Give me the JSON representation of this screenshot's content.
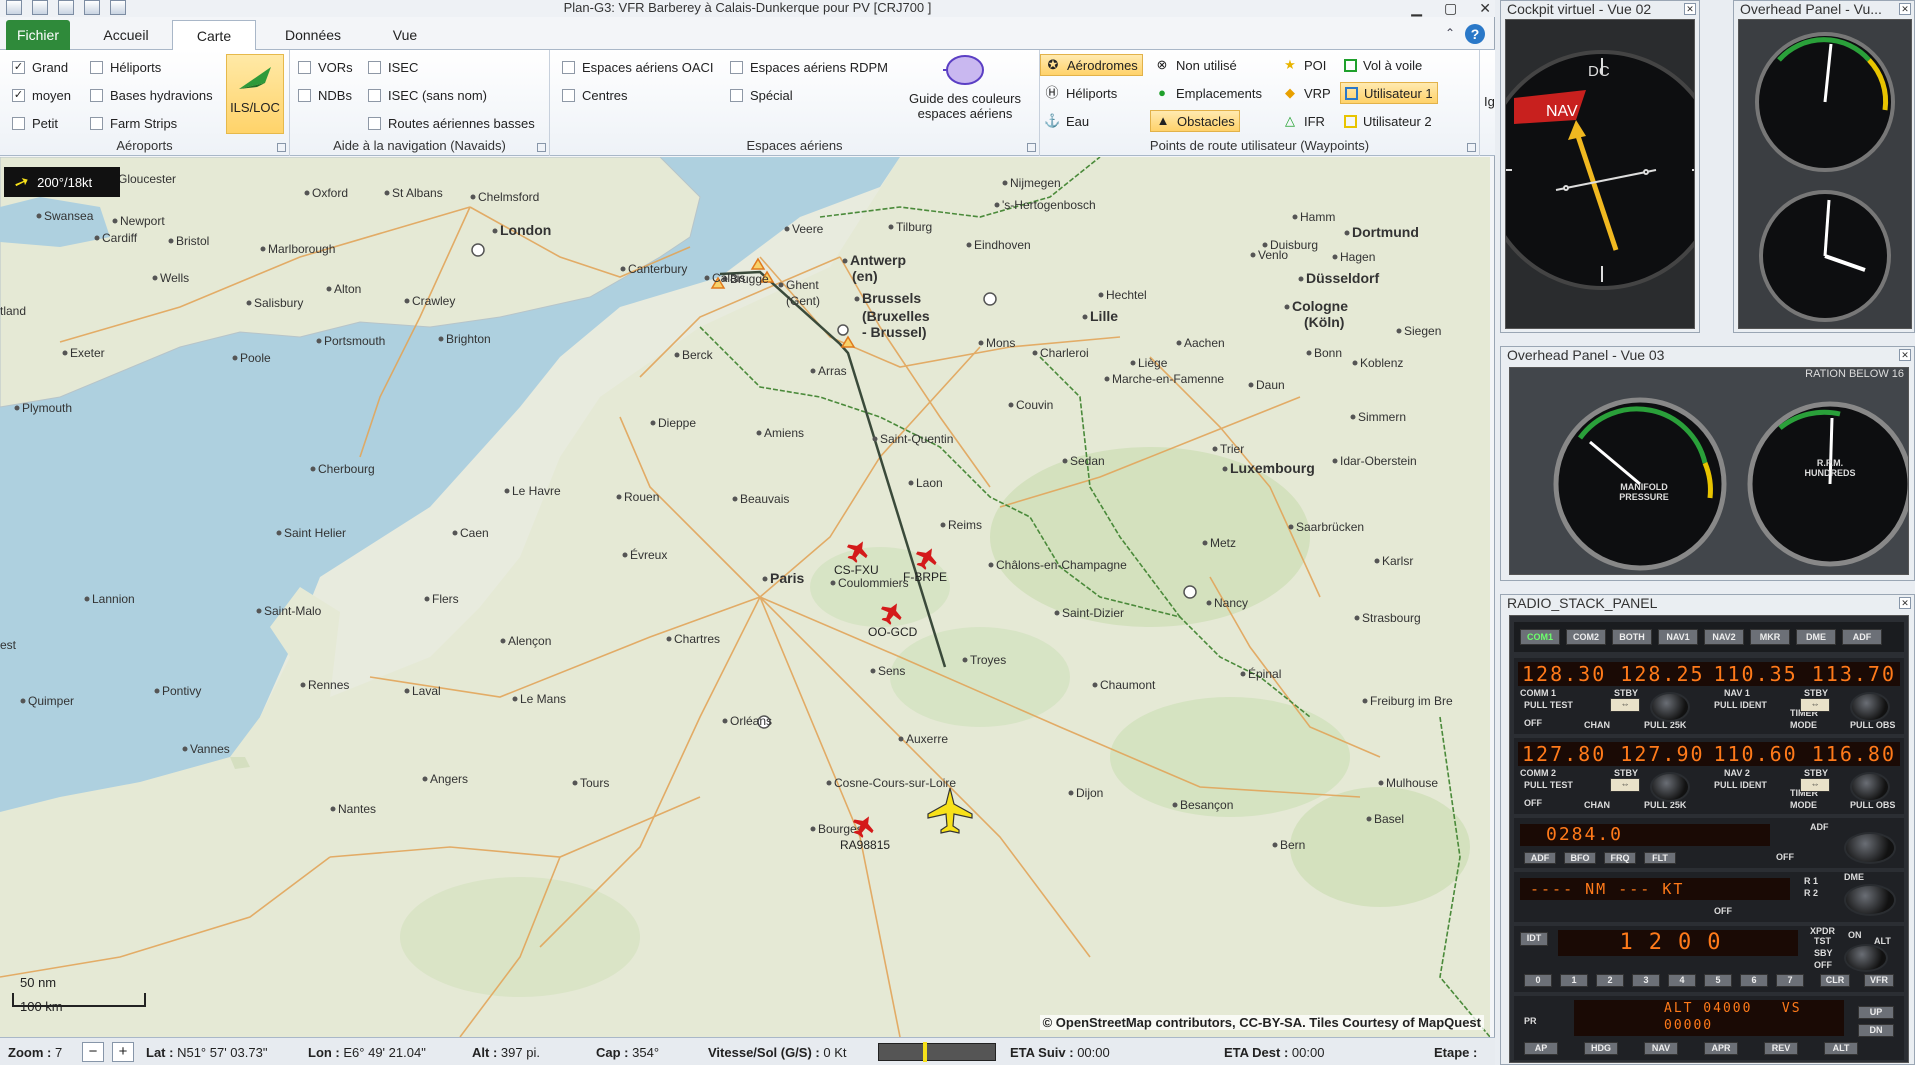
{
  "window": {
    "title": "Plan-G3: VFR Barberey à Calais-Dunkerque pour PV [CRJ700 ]"
  },
  "tabs": [
    {
      "label": "Fichier"
    },
    {
      "label": "Accueil"
    },
    {
      "label": "Carte"
    },
    {
      "label": "Données"
    },
    {
      "label": "Vue"
    }
  ],
  "ribbon": {
    "airports": {
      "label": "Aéroports",
      "items": [
        {
          "label": "Grand",
          "checked": true
        },
        {
          "label": "moyen",
          "checked": true
        },
        {
          "label": "Petit",
          "checked": false
        },
        {
          "label": "Héliports",
          "checked": false
        },
        {
          "label": "Bases hydravions",
          "checked": false
        },
        {
          "label": "Farm Strips",
          "checked": false
        }
      ],
      "ils_button": "ILS/LOC"
    },
    "navaids": {
      "label": "Aide à la navigation (Navaids)",
      "items": [
        {
          "label": "VORs",
          "checked": false
        },
        {
          "label": "NDBs",
          "checked": false
        },
        {
          "label": "ISEC",
          "checked": false
        },
        {
          "label": "ISEC (sans nom)",
          "checked": false
        },
        {
          "label": "Routes aériennes basses",
          "checked": false
        }
      ]
    },
    "airspaces": {
      "label": "Espaces aériens",
      "items": [
        {
          "label": "Espaces aériens OACI",
          "checked": false
        },
        {
          "label": "Centres",
          "checked": false
        },
        {
          "label": "Espaces aériens RDPM",
          "checked": false
        },
        {
          "label": "Spécial",
          "checked": false
        }
      ],
      "guide_line1": "Guide des couleurs",
      "guide_line2": "espaces aériens"
    },
    "waypoints": {
      "label": "Points de route utilisateur (Waypoints)",
      "items": [
        {
          "label": "Aérodromes",
          "selected": true
        },
        {
          "label": "Héliports",
          "selected": false
        },
        {
          "label": "Eau",
          "selected": false
        },
        {
          "label": "Non utilisé",
          "selected": false
        },
        {
          "label": "Emplacements",
          "selected": false
        },
        {
          "label": "Obstacles",
          "selected": true
        },
        {
          "label": "POI",
          "selected": false
        },
        {
          "label": "VRP",
          "selected": false
        },
        {
          "label": "IFR",
          "selected": false
        },
        {
          "label": "Vol à voile",
          "selected": false
        },
        {
          "label": "Utilisateur 1",
          "selected": true
        },
        {
          "label": "Utilisateur 2",
          "selected": false
        }
      ],
      "overflow": "Ig"
    }
  },
  "map": {
    "wind": "200°/18kt",
    "scale_nm": "50 nm",
    "scale_km": "100 km",
    "attribution": "© OpenStreetMap contributors, CC-BY-SA. Tiles Courtesy of MapQuest",
    "cities": [
      {
        "name": "Gloucester"
      },
      {
        "name": "Oxford"
      },
      {
        "name": "St Albans"
      },
      {
        "name": "Chelmsford"
      },
      {
        "name": "Swansea"
      },
      {
        "name": "Newport"
      },
      {
        "name": "Cardiff"
      },
      {
        "name": "Bristol"
      },
      {
        "name": "London"
      },
      {
        "name": "Marlborough"
      },
      {
        "name": "Wells"
      },
      {
        "name": "Salisbury"
      },
      {
        "name": "Alton"
      },
      {
        "name": "Crawley"
      },
      {
        "name": "Canterbury"
      },
      {
        "name": "Portsmouth"
      },
      {
        "name": "Brighton"
      },
      {
        "name": "Poole"
      },
      {
        "name": "Exeter"
      },
      {
        "name": "Plymouth"
      },
      {
        "name": "tland"
      },
      {
        "name": "Calais"
      },
      {
        "name": "Brugge"
      },
      {
        "name": "Ghent"
      },
      {
        "name": "(Gent)"
      },
      {
        "name": "Antwerp"
      },
      {
        "name": "(en)"
      },
      {
        "name": "Brussels"
      },
      {
        "name": "(Bruxelles"
      },
      {
        "name": "- Brussel)"
      },
      {
        "name": "Veere"
      },
      {
        "name": "Tilburg"
      },
      {
        "name": "Eindhoven"
      },
      {
        "name": "Nijmegen"
      },
      {
        "name": "'s-Hertogenbosch"
      },
      {
        "name": "Hamm"
      },
      {
        "name": "Dortmund"
      },
      {
        "name": "Duisburg"
      },
      {
        "name": "Hagen"
      },
      {
        "name": "Venlo"
      },
      {
        "name": "Düsseldorf"
      },
      {
        "name": "Cologne"
      },
      {
        "name": "(Köln)"
      },
      {
        "name": "Hechtel"
      },
      {
        "name": "Lille"
      },
      {
        "name": "Mons"
      },
      {
        "name": "Charleroi"
      },
      {
        "name": "Liège"
      },
      {
        "name": "Aachen"
      },
      {
        "name": "Bonn"
      },
      {
        "name": "Siegen"
      },
      {
        "name": "Berck"
      },
      {
        "name": "Arras"
      },
      {
        "name": "Marche-en-Famenne"
      },
      {
        "name": "Daun"
      },
      {
        "name": "Koblenz"
      },
      {
        "name": "Dieppe"
      },
      {
        "name": "Amiens"
      },
      {
        "name": "Saint-Quentin"
      },
      {
        "name": "Couvin"
      },
      {
        "name": "Simmern"
      },
      {
        "name": "Sedan"
      },
      {
        "name": "Trier"
      },
      {
        "name": "Idar-Oberstein"
      },
      {
        "name": "Luxembourg"
      },
      {
        "name": "Cherbourg"
      },
      {
        "name": "Le Havre"
      },
      {
        "name": "Rouen"
      },
      {
        "name": "Beauvais"
      },
      {
        "name": "Laon"
      },
      {
        "name": "Reims"
      },
      {
        "name": "Saarbrücken"
      },
      {
        "name": "Metz"
      },
      {
        "name": "Saint Helier"
      },
      {
        "name": "Caen"
      },
      {
        "name": "Évreux"
      },
      {
        "name": "Paris"
      },
      {
        "name": "Coulommiers"
      },
      {
        "name": "Châlons-en-Champagne"
      },
      {
        "name": "Karlsr"
      },
      {
        "name": "Lannion"
      },
      {
        "name": "Flers"
      },
      {
        "name": "Saint-Malo"
      },
      {
        "name": "Alençon"
      },
      {
        "name": "Chartres"
      },
      {
        "name": "Saint-Dizier"
      },
      {
        "name": "Nancy"
      },
      {
        "name": "Strasbourg"
      },
      {
        "name": "est"
      },
      {
        "name": "Rennes"
      },
      {
        "name": "Laval"
      },
      {
        "name": "Le Mans"
      },
      {
        "name": "Sens"
      },
      {
        "name": "Troyes"
      },
      {
        "name": "Chaumont"
      },
      {
        "name": "Épinal"
      },
      {
        "name": "Pontivy"
      },
      {
        "name": "Quimper"
      },
      {
        "name": "Orléans"
      },
      {
        "name": "Auxerre"
      },
      {
        "name": "Freiburg im Bre"
      },
      {
        "name": "Vannes"
      },
      {
        "name": "Angers"
      },
      {
        "name": "Tours"
      },
      {
        "name": "Mulhouse"
      },
      {
        "name": "Basel"
      },
      {
        "name": "Nantes"
      },
      {
        "name": "Cosne-Cours-sur-Loire"
      },
      {
        "name": "Dijon"
      },
      {
        "name": "Besançon"
      },
      {
        "name": "Bourges"
      },
      {
        "name": "Bern"
      }
    ],
    "aircraft": [
      {
        "callsign": "CS-FXU"
      },
      {
        "callsign": "F-BRPE"
      },
      {
        "callsign": "OO-GCD"
      },
      {
        "callsign": "RA98815"
      }
    ]
  },
  "status": {
    "zoom_label": "Zoom :",
    "zoom_value": "7",
    "zoom_minus": "−",
    "zoom_plus": "+",
    "lat_label": "Lat :",
    "lat_value": "N51° 57' 03.73\"",
    "lon_label": "Lon :",
    "lon_value": "E6° 49' 21.04\"",
    "alt_label": "Alt :",
    "alt_value": "397 pi.",
    "cap_label": "Cap :",
    "cap_value": "354°",
    "speed_label": "Vitesse/Sol (G/S) :",
    "speed_value": "0 Kt",
    "eta_next_label": "ETA Suiv :",
    "eta_next_value": "00:00",
    "eta_dest_label": "ETA Dest :",
    "eta_dest_value": "00:00",
    "step_label": "Etape :"
  },
  "panels": {
    "cockpit": {
      "title": "Cockpit virtuel - Vue 02",
      "dc": "DC",
      "nav": "NAV"
    },
    "overhead1": {
      "title": "Overhead Panel - Vu..."
    },
    "overhead3": {
      "title": "Overhead Panel - Vue 03",
      "banner": "RATION BELOW 16",
      "g1_label": "MANIFOLD PRESSURE",
      "g2_label": "R.P.M. HUNDREDS"
    },
    "radio": {
      "title": "RADIO_STACK_PANEL",
      "buttons": [
        "COM1",
        "COM2",
        "BOTH",
        "NAV1",
        "NAV2",
        "MKR",
        "DME",
        "ADF"
      ],
      "com1": "128.30 128.25",
      "nav1": "110.35 113.70",
      "com2": "127.80 127.90",
      "nav2": "110.60 116.80",
      "adf": "0284.0",
      "dme": "---- NM --- KT",
      "xpdr": "1200",
      "alt_vs": "ALT 04000   VS 00000",
      "labels": {
        "comm1": "COMM 1",
        "stby": "STBY",
        "nav1": "NAV 1",
        "pull_test": "PULL TEST",
        "off": "OFF",
        "chan": "CHAN",
        "pull25": "PULL 25K",
        "pull_ident": "PULL IDENT",
        "timer": "TIMER",
        "mode": "MODE",
        "pull_obs": "PULL OBS",
        "comm2": "COMM 2",
        "nav2": "NAV 2",
        "adf_label": "ADF",
        "dme_label": "DME",
        "r1": "R 1",
        "r2": "R 2",
        "xpdr_label": "XPDR",
        "on": "ON",
        "sby": "SBY",
        "alt_label": "ALT",
        "tst": "TST",
        "idt": "IDT",
        "clr": "CLR",
        "vfr": "VFR",
        "up": "UP",
        "dn": "DN",
        "pr": "PR"
      },
      "adf_buttons": [
        "ADF",
        "BFO",
        "FRQ",
        "FLT"
      ],
      "digits": [
        "0",
        "1",
        "2",
        "3",
        "4",
        "5",
        "6",
        "7"
      ],
      "ap_buttons": [
        "AP",
        "HDG",
        "NAV",
        "APR",
        "REV",
        "ALT"
      ]
    }
  }
}
